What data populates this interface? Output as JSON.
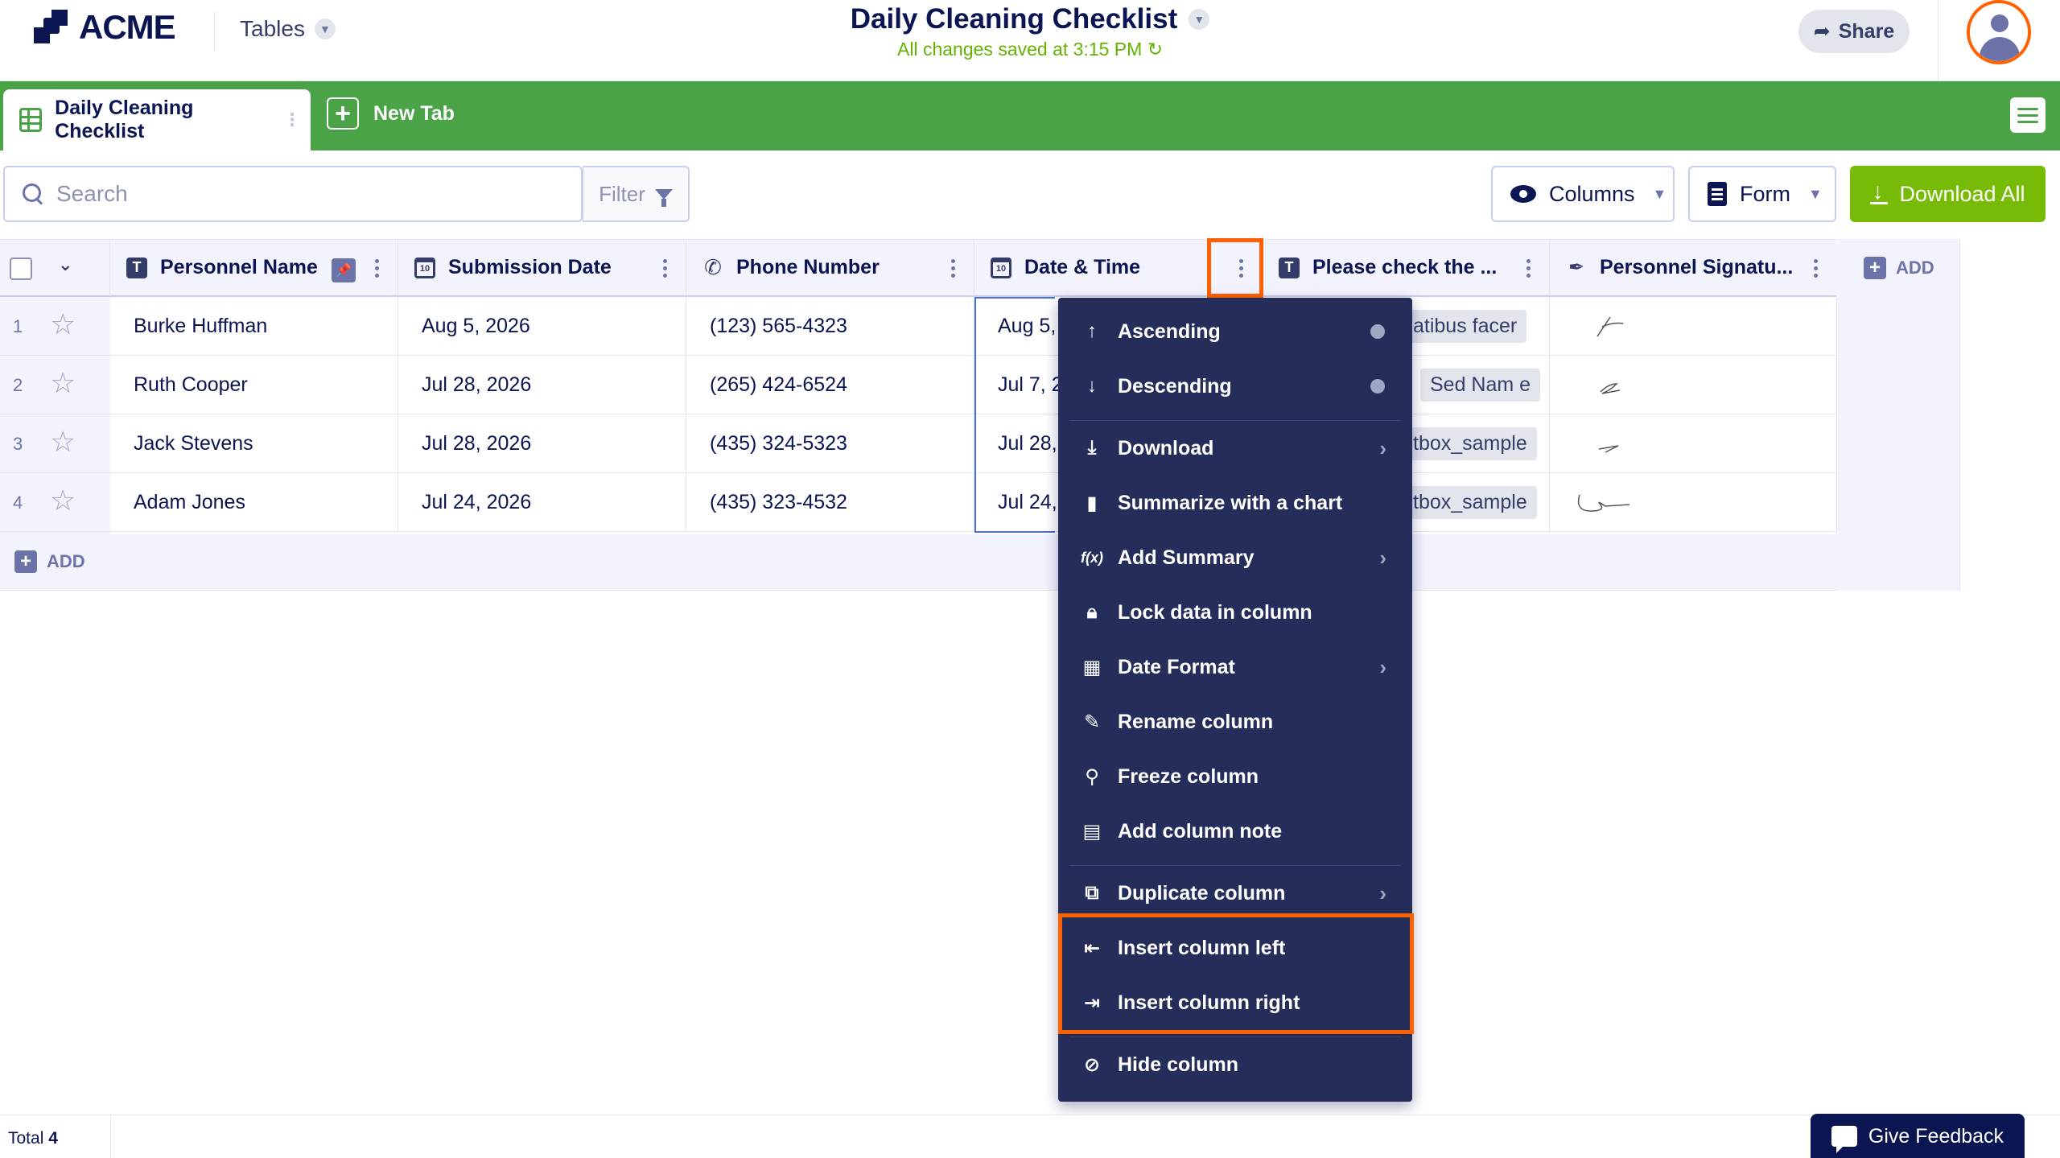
{
  "header": {
    "logo_text": "ACME",
    "app_menu_label": "Tables",
    "doc_title": "Daily Cleaning Checklist",
    "save_status": "All changes saved at 3:15 PM",
    "share_label": "Share"
  },
  "tabs": {
    "active_label": "Daily Cleaning Checklist",
    "new_tab_label": "New Tab"
  },
  "toolbar": {
    "search_placeholder": "Search",
    "filter_label": "Filter",
    "columns_label": "Columns",
    "form_label": "Form",
    "download_all_label": "Download All"
  },
  "table": {
    "columns": [
      {
        "label": "Personnel Name",
        "icon": "text-icon"
      },
      {
        "label": "Submission Date",
        "icon": "calendar-icon"
      },
      {
        "label": "Phone Number",
        "icon": "phone-icon"
      },
      {
        "label": "Date & Time",
        "icon": "calendar-icon"
      },
      {
        "label": "Please check the ...",
        "icon": "text-icon"
      },
      {
        "label": "Personnel Signatu...",
        "icon": "signature-icon"
      }
    ],
    "add_column_label": "ADD",
    "rows": [
      {
        "num": "1",
        "name": "Burke Huffman",
        "submission": "Aug 5, 2026",
        "phone": "(123) 565-4323",
        "datetime": "Aug 5,",
        "check": "atibus facer"
      },
      {
        "num": "2",
        "name": "Ruth Cooper",
        "submission": "Jul 28, 2026",
        "phone": "(265) 424-6524",
        "datetime": "Jul 7, 2",
        "check": "Sed Nam e"
      },
      {
        "num": "3",
        "name": "Jack Stevens",
        "submission": "Jul 28, 2026",
        "phone": "(435) 324-5323",
        "datetime": "Jul 28,",
        "check": "tbox_sample"
      },
      {
        "num": "4",
        "name": "Adam Jones",
        "submission": "Jul 24, 2026",
        "phone": "(435) 323-4532",
        "datetime": "Jul 24,",
        "check": "tbox_sample"
      }
    ],
    "add_row_label": "ADD"
  },
  "menu": {
    "items": [
      {
        "label": "Ascending",
        "icon": "arrow-up-icon"
      },
      {
        "label": "Descending",
        "icon": "arrow-down-icon"
      },
      {
        "label": "Download",
        "icon": "download-icon"
      },
      {
        "label": "Summarize with a chart",
        "icon": "bar-chart-icon"
      },
      {
        "label": "Add Summary",
        "icon": "function-icon"
      },
      {
        "label": "Lock data in column",
        "icon": "lock-icon"
      },
      {
        "label": "Date Format",
        "icon": "calendar-icon"
      },
      {
        "label": "Rename column",
        "icon": "pencil-icon"
      },
      {
        "label": "Freeze column",
        "icon": "pin-icon"
      },
      {
        "label": "Add column note",
        "icon": "note-icon"
      },
      {
        "label": "Duplicate column",
        "icon": "duplicate-icon"
      },
      {
        "label": "Insert column left",
        "icon": "insert-left-icon"
      },
      {
        "label": "Insert column right",
        "icon": "insert-right-icon"
      },
      {
        "label": "Hide column",
        "icon": "eye-off-icon"
      }
    ]
  },
  "footer": {
    "total_label": "Total",
    "total_count": "4",
    "feedback_label": "Give Feedback"
  },
  "colors": {
    "brand_navy": "#0a1551",
    "tab_green": "#4aa347",
    "download_green": "#78bb07",
    "saved_green": "#64b200",
    "highlight_orange": "#ff6100",
    "menu_bg": "#252d5b"
  }
}
